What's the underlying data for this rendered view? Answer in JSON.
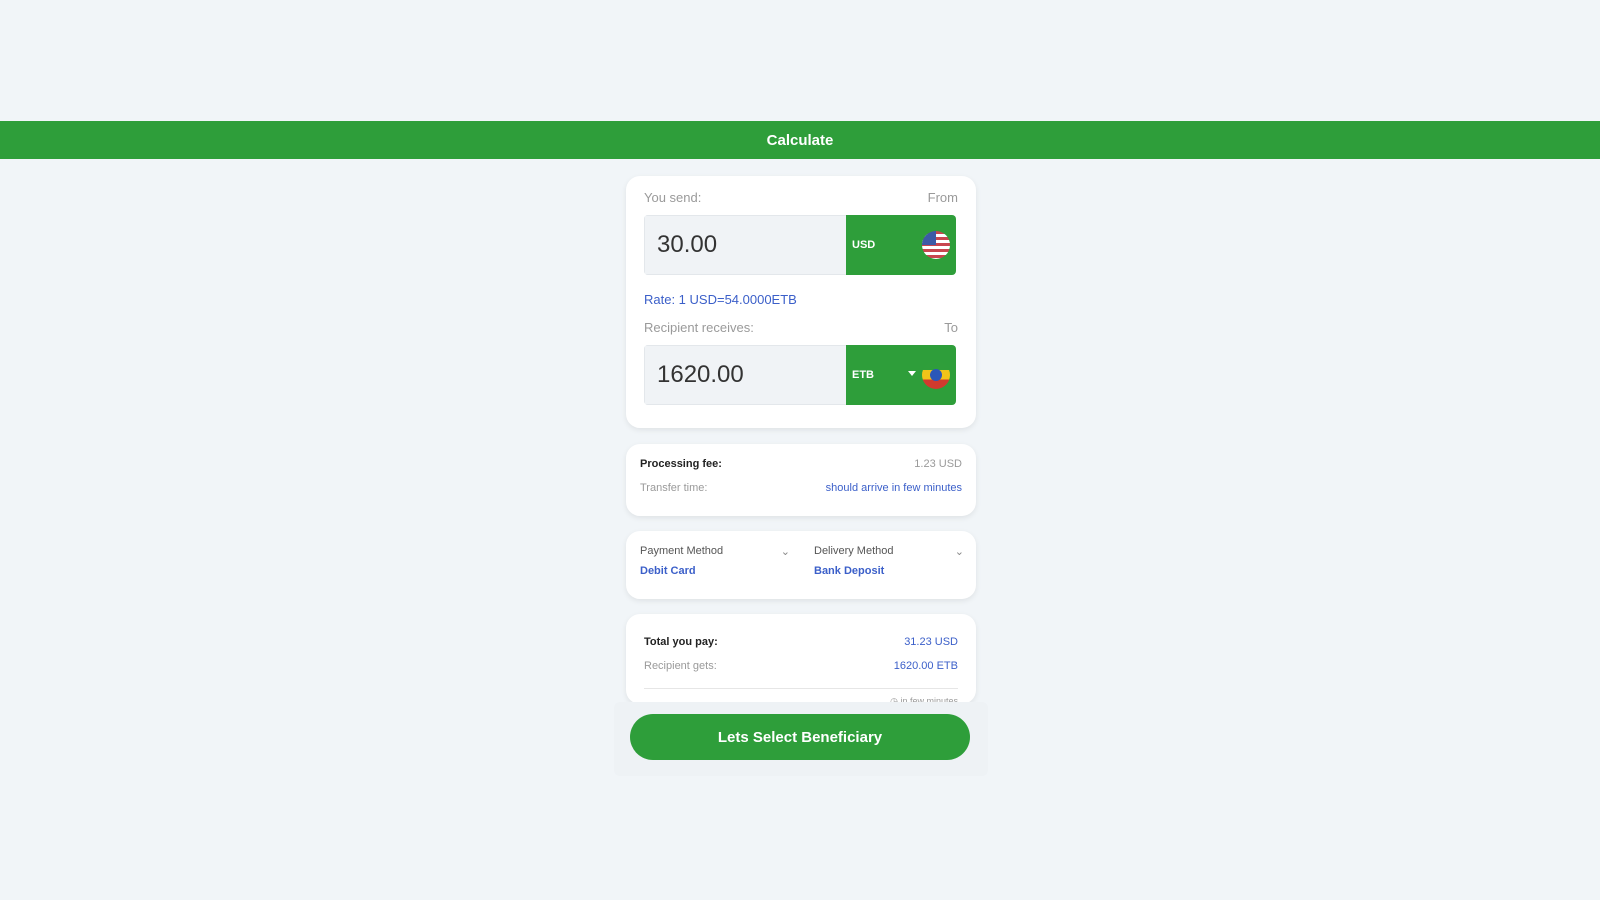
{
  "header": {
    "title": "Calculate"
  },
  "send": {
    "label": "You send:",
    "from_label": "From",
    "amount": "30.00",
    "currency": "USD"
  },
  "rate": "Rate: 1 USD=54.0000ETB",
  "receive": {
    "label": "Recipient receives:",
    "to_label": "To",
    "amount": "1620.00",
    "currency": "ETB"
  },
  "fees": {
    "processing_label": "Processing fee:",
    "processing_value": "1.23 USD",
    "transfer_label": "Transfer time:",
    "transfer_value": "should arrive in few minutes"
  },
  "methods": {
    "payment_label": "Payment Method",
    "payment_value": "Debit Card",
    "delivery_label": "Delivery Method",
    "delivery_value": "Bank Deposit"
  },
  "totals": {
    "total_label": "Total you pay:",
    "total_value": "31.23 USD",
    "recipient_label": "Recipient gets:",
    "recipient_value": "1620.00 ETB",
    "arrival_note": "in few minutes"
  },
  "cta": {
    "label": "Lets Select Beneficiary"
  },
  "colors": {
    "primary": "#2e9e3a",
    "link": "#3b5fc9",
    "background": "#f1f5f8"
  },
  "icons": {
    "send_flag": "us-flag-icon",
    "receive_flag": "ethiopia-flag-icon",
    "dropdown": "caret-down-icon",
    "chevron": "chevron-down-icon",
    "clock": "clock-icon"
  }
}
